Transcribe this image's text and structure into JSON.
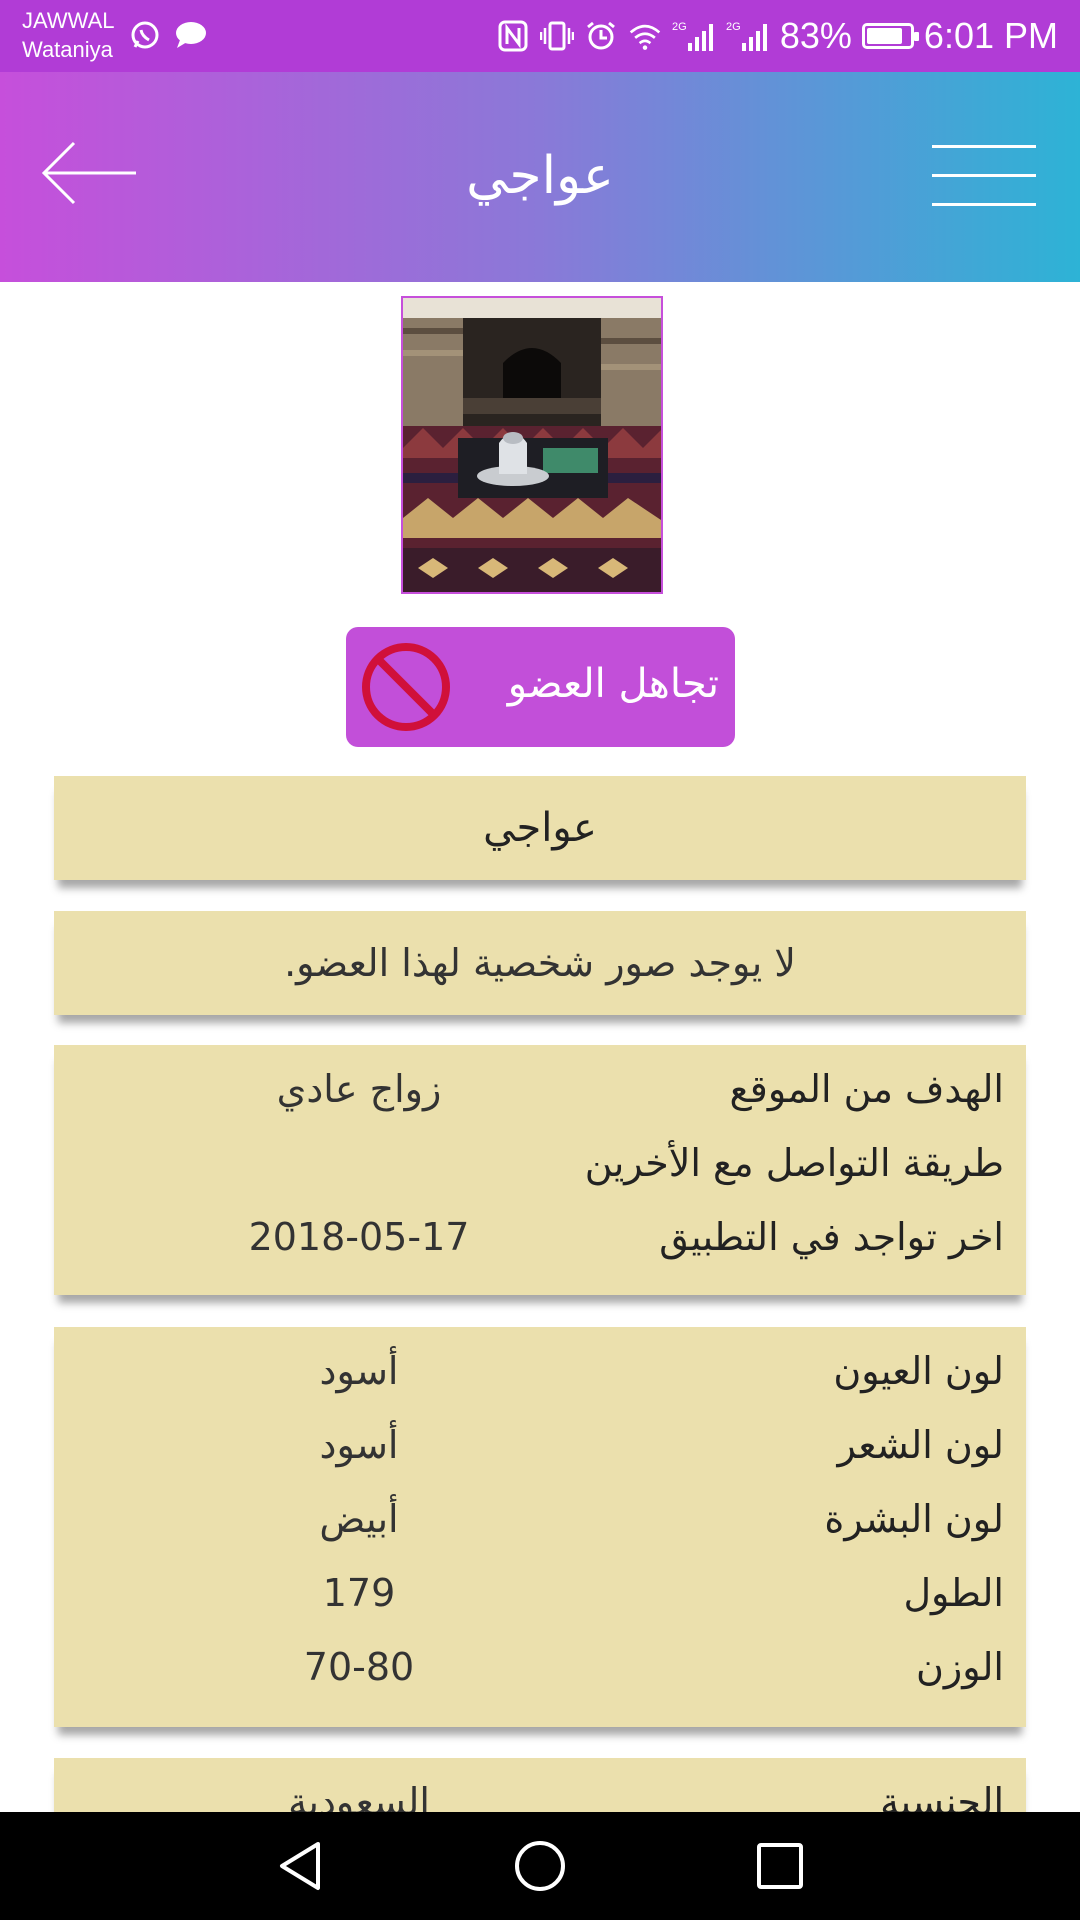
{
  "status_bar": {
    "carrier_line1": "JAWWAL",
    "carrier_line2": "Wataniya",
    "net1": "2G",
    "net2": "2G",
    "battery_percent": "83%",
    "battery_level": 0.83,
    "time": "6:01 PM"
  },
  "header": {
    "title": "عواجي"
  },
  "ignore_button": {
    "label": "تجاهل العضو"
  },
  "profile": {
    "name": "عواجي",
    "no_photos_message": "لا يوجد صور شخصية لهذا العضو."
  },
  "info_group_1": [
    {
      "label": "الهدف من الموقع",
      "value": "زواج عادي"
    },
    {
      "label": "طريقة التواصل مع الأخرين",
      "value": ""
    },
    {
      "label": "اخر تواجد في التطبيق",
      "value": "2018-05-17"
    }
  ],
  "info_group_2": [
    {
      "label": "لون العيون",
      "value": "أسود"
    },
    {
      "label": "لون الشعر",
      "value": "أسود"
    },
    {
      "label": "لون البشرة",
      "value": "أبيض"
    },
    {
      "label": "الطول",
      "value": "179"
    },
    {
      "label": "الوزن",
      "value": "70-80"
    }
  ],
  "info_group_3": [
    {
      "label": "الجنسية",
      "value": "السعودية"
    }
  ],
  "colors": {
    "header_gradient_start": "#c64fdb",
    "header_gradient_end": "#2db3d6",
    "card_background": "#ebe0ad",
    "ignore_button": "#c24fd9",
    "prohibited_icon": "#d0103a"
  }
}
